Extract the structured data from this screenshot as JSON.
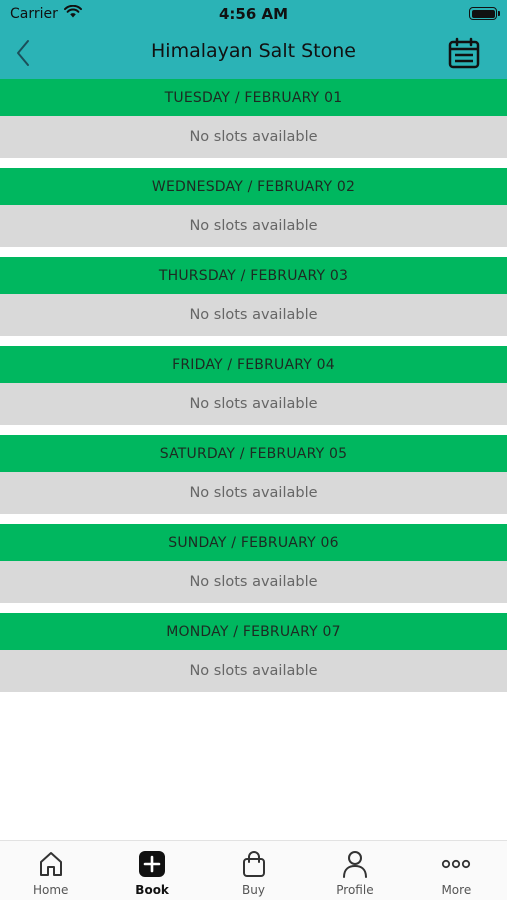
{
  "status_bar": {
    "carrier": "Carrier",
    "time": "4:56 AM"
  },
  "header": {
    "title": "Himalayan Salt Stone",
    "back_icon": "chevron-left-icon",
    "calendar_icon": "calendar-icon"
  },
  "colors": {
    "header": "#2bb3b6",
    "day_header": "#00b75f",
    "slot_bg": "#d9d9d9"
  },
  "days": [
    {
      "label": "TUESDAY / FEBRUARY 01",
      "message": "No slots available"
    },
    {
      "label": "WEDNESDAY / FEBRUARY 02",
      "message": "No slots available"
    },
    {
      "label": "THURSDAY / FEBRUARY 03",
      "message": "No slots available"
    },
    {
      "label": "FRIDAY / FEBRUARY 04",
      "message": "No slots available"
    },
    {
      "label": "SATURDAY / FEBRUARY 05",
      "message": "No slots available"
    },
    {
      "label": "SUNDAY / FEBRUARY 06",
      "message": "No slots available"
    },
    {
      "label": "MONDAY / FEBRUARY 07",
      "message": "No slots available"
    }
  ],
  "tabs": [
    {
      "label": "Home",
      "icon": "home-icon"
    },
    {
      "label": "Book",
      "icon": "plus-square-icon",
      "active": true
    },
    {
      "label": "Buy",
      "icon": "shopping-bag-icon"
    },
    {
      "label": "Profile",
      "icon": "person-icon"
    },
    {
      "label": "More",
      "icon": "more-dots-icon"
    }
  ]
}
